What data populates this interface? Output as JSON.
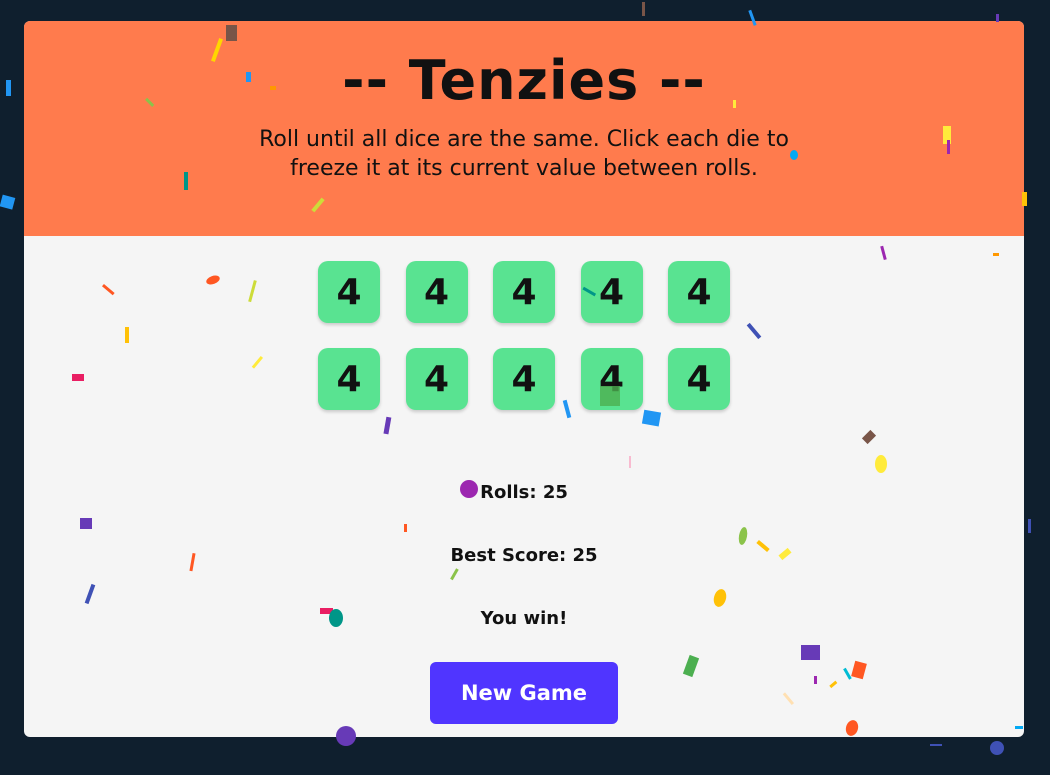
{
  "header": {
    "title": "-- Tenzies --",
    "instructions": "Roll until all dice are the same. Click each die to freeze it at its current value between rolls."
  },
  "dice": [
    {
      "value": "4",
      "held": false
    },
    {
      "value": "4",
      "held": false
    },
    {
      "value": "4",
      "held": false
    },
    {
      "value": "4",
      "held": false
    },
    {
      "value": "4",
      "held": false
    },
    {
      "value": "4",
      "held": false
    },
    {
      "value": "4",
      "held": false
    },
    {
      "value": "4",
      "held": false
    },
    {
      "value": "4",
      "held": false
    },
    {
      "value": "4",
      "held": false
    }
  ],
  "stats": {
    "rolls": "Rolls: 25",
    "best_score": "Best Score: 25",
    "status": "You win!"
  },
  "buttons": {
    "new_game": "New Game"
  },
  "colors": {
    "page_background": "#0f1f2e",
    "header_background": "#ff7b4d",
    "die_color": "#59e391",
    "button_color": "#5035ff",
    "panel_background": "#f5f5f5"
  },
  "decorations": {
    "confetti": "confetti-celebration"
  }
}
